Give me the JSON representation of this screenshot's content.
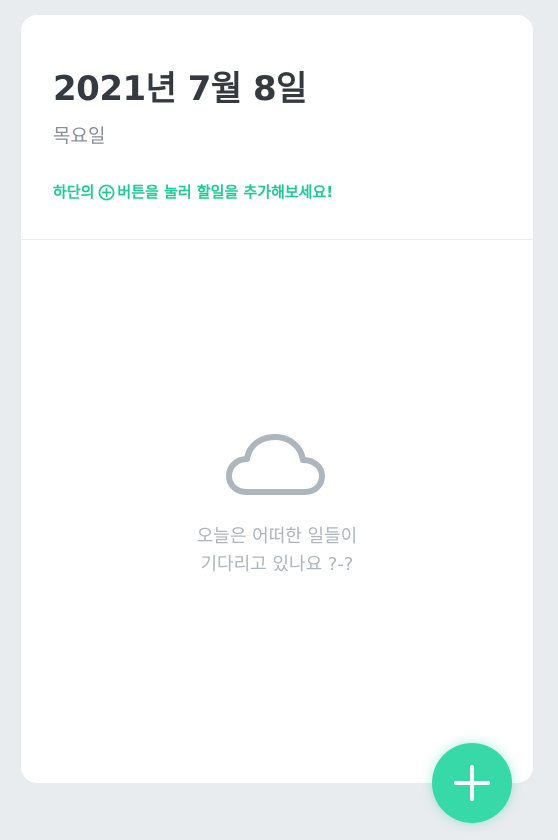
{
  "header": {
    "date": "2021년 7월 8일",
    "weekday": "목요일",
    "hint_before": "하단의",
    "hint_after": "버튼을 눌러 할일을 추가해보세요!"
  },
  "empty_state": {
    "line1": "오늘은 어떠한 일들이",
    "line2": "기다리고 있나요 ?-?"
  },
  "icons": {
    "hint_icon": "plus-circle-icon",
    "empty_icon": "cloud-icon",
    "fab_icon": "plus-icon"
  },
  "colors": {
    "accent": "#20c997",
    "fab": "#38d9a9",
    "background": "#e9ecef",
    "title": "#343a40",
    "muted": "#868e96",
    "empty": "#adb5bd"
  }
}
